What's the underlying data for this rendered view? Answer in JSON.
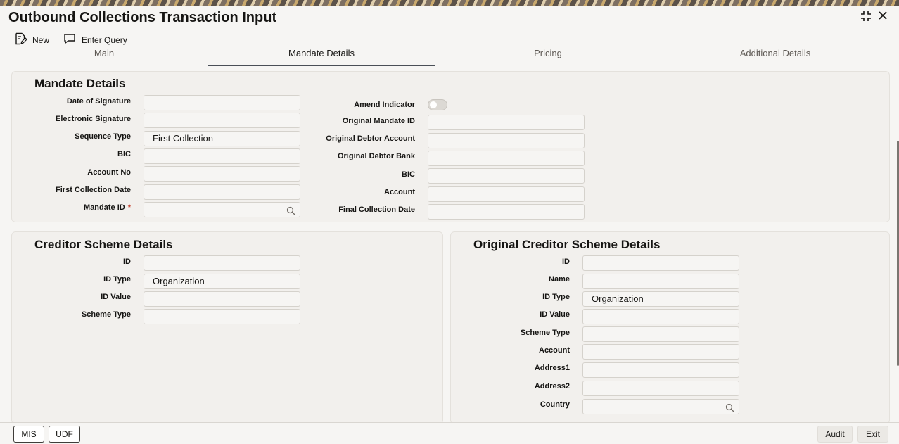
{
  "window": {
    "title": "Outbound Collections Transaction Input"
  },
  "toolbar": {
    "new_label": "New",
    "enter_query_label": "Enter Query"
  },
  "tabs": [
    {
      "label": "Main"
    },
    {
      "label": "Mandate Details"
    },
    {
      "label": "Pricing"
    },
    {
      "label": "Additional Details"
    }
  ],
  "mandate": {
    "title": "Mandate Details",
    "date_of_signature": {
      "label": "Date of Signature",
      "value": ""
    },
    "electronic_signature": {
      "label": "Electronic Signature",
      "value": ""
    },
    "sequence_type": {
      "label": "Sequence Type",
      "value": "First Collection"
    },
    "bic": {
      "label": "BIC",
      "value": ""
    },
    "account_no": {
      "label": "Account No",
      "value": ""
    },
    "first_collection_date": {
      "label": "First Collection Date",
      "value": ""
    },
    "mandate_id": {
      "label": "Mandate ID",
      "required": "*",
      "value": ""
    },
    "amend_indicator": {
      "label": "Amend Indicator",
      "value": "off"
    },
    "original_mandate_id": {
      "label": "Original Mandate ID",
      "value": ""
    },
    "original_debtor_account": {
      "label": "Original Debtor Account",
      "value": ""
    },
    "original_debtor_bank": {
      "label": "Original Debtor Bank",
      "value": ""
    },
    "orig_bic": {
      "label": "BIC",
      "value": ""
    },
    "account": {
      "label": "Account",
      "value": ""
    },
    "final_collection_date": {
      "label": "Final Collection Date",
      "value": ""
    }
  },
  "creditor": {
    "title": "Creditor Scheme Details",
    "id": {
      "label": "ID",
      "value": ""
    },
    "id_type": {
      "label": "ID Type",
      "value": "Organization"
    },
    "id_value": {
      "label": "ID Value",
      "value": ""
    },
    "scheme_type": {
      "label": "Scheme Type",
      "value": ""
    }
  },
  "orig_creditor": {
    "title": "Original Creditor Scheme Details",
    "id": {
      "label": "ID",
      "value": ""
    },
    "name": {
      "label": "Name",
      "value": ""
    },
    "id_type": {
      "label": "ID Type",
      "value": "Organization"
    },
    "id_value": {
      "label": "ID Value",
      "value": ""
    },
    "scheme_type": {
      "label": "Scheme Type",
      "value": ""
    },
    "account": {
      "label": "Account",
      "value": ""
    },
    "address1": {
      "label": "Address1",
      "value": ""
    },
    "address2": {
      "label": "Address2",
      "value": ""
    },
    "country": {
      "label": "Country",
      "value": ""
    }
  },
  "footer": {
    "mis": "MIS",
    "udf": "UDF",
    "audit": "Audit",
    "exit": "Exit"
  },
  "icons": [
    "new-document-icon",
    "enter-query-icon",
    "maximize-icon",
    "close-icon",
    "search-icon"
  ],
  "colors": {
    "accent_tab_underline": "#4a4f57",
    "required": "#c74634",
    "background": "#f6f5f3"
  }
}
